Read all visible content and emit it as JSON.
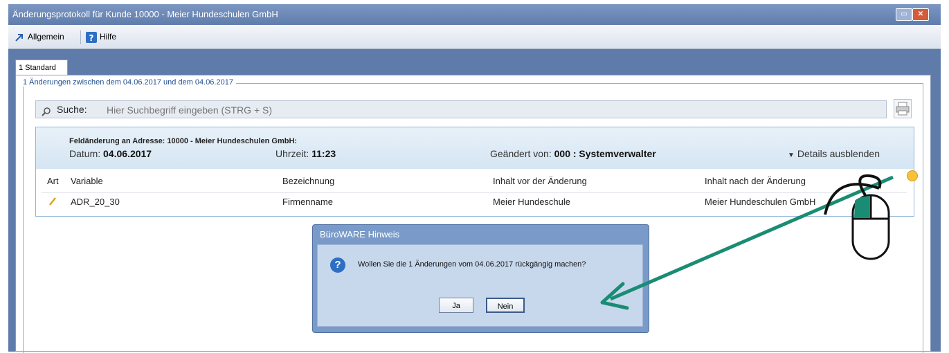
{
  "window": {
    "title": "Änderungsprotokoll für Kunde 10000 - Meier Hundeschulen GmbH",
    "buttons": {
      "minimize": "▭",
      "close": "✕"
    }
  },
  "toolbar": {
    "items": [
      {
        "label": "Allgemein",
        "icon": "arrow-up-right-icon"
      },
      {
        "label": "Hilfe",
        "icon": "help-icon"
      }
    ]
  },
  "tabs": [
    {
      "label": "1 Standard"
    }
  ],
  "group": {
    "label": "1 Änderungen zwischen dem 04.06.2017 und dem 04.06.2017"
  },
  "search": {
    "label": "Suche:",
    "placeholder": "Hier Suchbegriff eingeben (STRG + S)"
  },
  "change": {
    "title": "Feldänderung an Adresse: 10000 - Meier Hundeschulen GmbH:",
    "date_label": "Datum:",
    "date": "04.06.2017",
    "time_label": "Uhrzeit:",
    "time": "11:23",
    "changed_by_label": "Geändert von:",
    "changed_by": "000 : Systemverwalter",
    "details_toggle": "Details ausblenden"
  },
  "table": {
    "headers": [
      "Art",
      "Variable",
      "Bezeichnung",
      "Inhalt vor der Änderung",
      "Inhalt nach der Änderung"
    ],
    "rows": [
      {
        "art_icon": "pencil-icon",
        "variable": "ADR_20_30",
        "bezeichnung": "Firmenname",
        "vorher": "Meier Hundeschule",
        "nachher": "Meier Hundeschulen GmbH"
      }
    ]
  },
  "dialog": {
    "title": "BüroWARE Hinweis",
    "message": "Wollen Sie die 1 Änderungen vom 04.06.2017 rückgängig machen?",
    "yes": "Ja",
    "no": "Nein"
  },
  "colors": {
    "window_frame": "#5e7baa",
    "panel_header": "#d5e5f3",
    "annotation_arrow": "#1a8c74"
  }
}
